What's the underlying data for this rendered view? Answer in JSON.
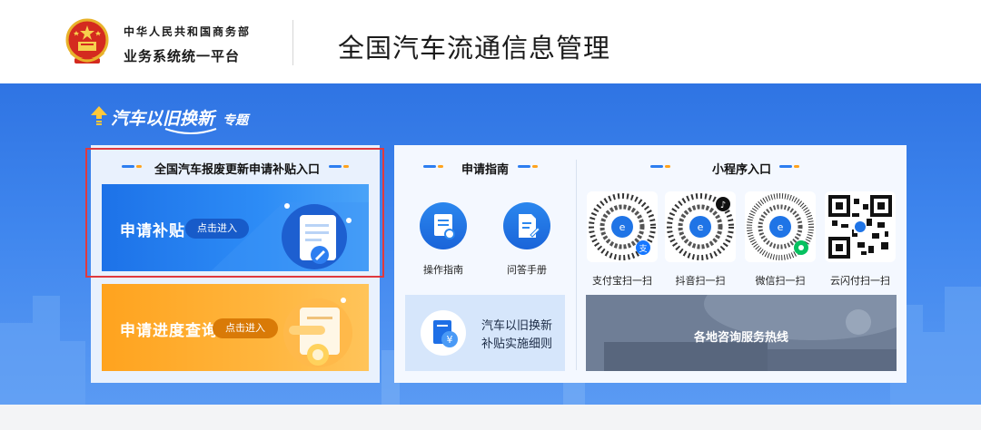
{
  "header": {
    "org_line1": "中华人民共和国商务部",
    "org_line2": "业务系统统一平台",
    "title": "全国汽车流通信息管理",
    "emblem_icon": "national-emblem-icon"
  },
  "banner": {
    "topic_main": "汽车以旧换新",
    "topic_sub": "专题"
  },
  "subsidy_section": {
    "title": "全国汽车报废更新申请补贴入口",
    "apply_card": {
      "title": "申请补贴",
      "enter_label": "点击进入",
      "icon": "document-edit-icon"
    },
    "progress_card": {
      "title": "申请进度查询",
      "enter_label": "点击进入",
      "icon": "search-document-icon"
    }
  },
  "guide_section": {
    "title": "申请指南",
    "items": [
      {
        "label": "操作指南",
        "icon": "certificate-icon"
      },
      {
        "label": "问答手册",
        "icon": "document-pen-icon"
      }
    ],
    "detail_card": {
      "line1": "汽车以旧换新",
      "line2": "补贴实施细则",
      "icon": "yuan-document-icon"
    }
  },
  "miniprogram_section": {
    "title": "小程序入口",
    "qr_codes": [
      {
        "label": "支付宝扫一扫",
        "icon": "alipay-qr-icon"
      },
      {
        "label": "抖音扫一扫",
        "icon": "douyin-qr-icon"
      },
      {
        "label": "微信扫一扫",
        "icon": "wechat-qr-icon"
      },
      {
        "label": "云闪付扫一扫",
        "icon": "unionpay-qr-icon"
      }
    ],
    "hotline": {
      "label": "各地咨询服务热线"
    }
  },
  "colors": {
    "banner_blue": "#3f86ee",
    "apply_blue": "#1d72e8",
    "progress_orange": "#ffa31e",
    "highlight_red": "#e0393e"
  }
}
